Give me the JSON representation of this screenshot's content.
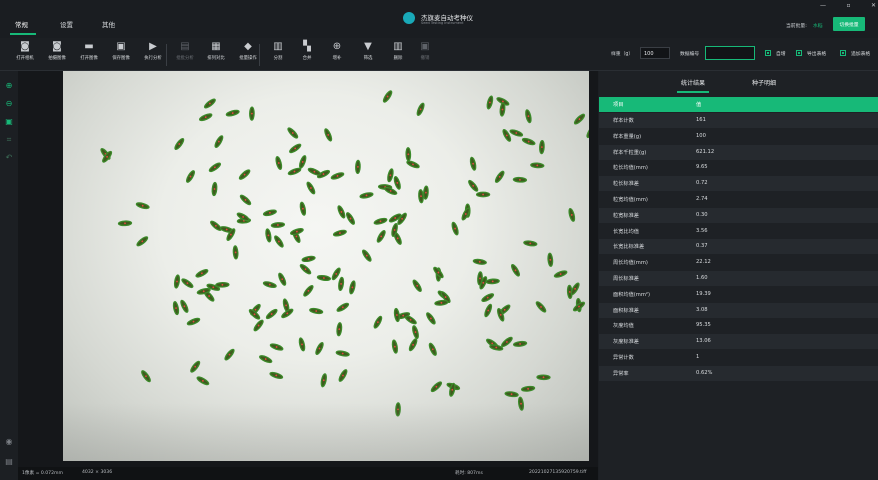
{
  "menu": {
    "tabs": [
      "常规",
      "设置",
      "其他"
    ]
  },
  "header": {
    "title": "杰旗麦自动考种仪",
    "subtitle": "Seed Testing Instrument",
    "scheme_label": "当前批量:",
    "scheme_value": "水稻",
    "switch_button": "切换批量",
    "window_controls": [
      "—",
      "▫",
      "✕"
    ]
  },
  "toolbar": {
    "buttons": [
      {
        "label": "打开相机",
        "icon": "camera-icon",
        "glyph": "◙",
        "disabled": false
      },
      {
        "label": "拍摄图像",
        "icon": "capture-icon",
        "glyph": "◙",
        "disabled": false
      },
      {
        "label": "打开图像",
        "icon": "folder-icon",
        "glyph": "▬",
        "disabled": false
      },
      {
        "label": "保存图像",
        "icon": "save-icon",
        "glyph": "▣",
        "disabled": false
      },
      {
        "label": "执行分析",
        "icon": "play-icon",
        "glyph": "▶",
        "disabled": false
      },
      {
        "label": "批批分析",
        "icon": "batch-analyze-icon",
        "glyph": "▤",
        "disabled": true
      },
      {
        "label": "排列对比",
        "icon": "grid-icon",
        "glyph": "▦",
        "disabled": false
      },
      {
        "label": "批量操作",
        "icon": "layers-icon",
        "glyph": "◆",
        "disabled": false
      },
      {
        "label": "分割",
        "icon": "split-icon",
        "glyph": "▥",
        "disabled": false
      },
      {
        "label": "合并",
        "icon": "merge-icon",
        "glyph": "▚",
        "disabled": false
      },
      {
        "label": "增补",
        "icon": "add-icon",
        "glyph": "⊕",
        "disabled": false
      },
      {
        "label": "筛选",
        "icon": "filter-icon",
        "glyph": "▼",
        "disabled": false
      },
      {
        "label": "删除",
        "icon": "trash-icon",
        "glyph": "▥",
        "disabled": false
      },
      {
        "label": "撤销",
        "icon": "undo-icon",
        "glyph": "▣",
        "disabled": true
      }
    ],
    "weight_label": "样重（g）",
    "weight_value": "100",
    "data_label": "数据编号",
    "data_value": "",
    "checkboxes": [
      {
        "label": "自增",
        "checked": true
      },
      {
        "label": "导出表格",
        "checked": true
      },
      {
        "label": "追加表格",
        "checked": true
      }
    ]
  },
  "left_rail": [
    "zoom-in-icon",
    "zoom-out-icon",
    "fit-icon",
    "crop-icon",
    "undo-icon",
    "eye-icon",
    "lock-icon"
  ],
  "status": {
    "scale": "1像素 = 0.072mm",
    "resolution": "4032 × 3036",
    "time": "耗时: 807ms",
    "filename": "20221027135920759.tiff"
  },
  "result_tabs": [
    "统计结果",
    "种子明细"
  ],
  "table": {
    "headers": [
      "项目",
      "值"
    ],
    "rows": [
      [
        "样本计数",
        "161"
      ],
      [
        "样本重量(g)",
        "100"
      ],
      [
        "样本千粒重(g)",
        "621.12"
      ],
      [
        "粒长均值(mm)",
        "9.65"
      ],
      [
        "粒长标准差",
        "0.72"
      ],
      [
        "粒宽均值(mm)",
        "2.74"
      ],
      [
        "粒宽标准差",
        "0.30"
      ],
      [
        "长宽比均值",
        "3.56"
      ],
      [
        "长宽比标准差",
        "0.37"
      ],
      [
        "周长均值(mm)",
        "22.12"
      ],
      [
        "周长标准差",
        "1.60"
      ],
      [
        "面积均值(mm²)",
        "19.39"
      ],
      [
        "面积标准差",
        "3.08"
      ],
      [
        "灰度均值",
        "95.35"
      ],
      [
        "灰度标准差",
        "13.06"
      ],
      [
        "异常计数",
        "1"
      ],
      [
        "异常率",
        "0.62%"
      ]
    ]
  },
  "colors": {
    "accent": "#17b978",
    "seed": "#3c8a2a",
    "background": "#1c1f23"
  }
}
